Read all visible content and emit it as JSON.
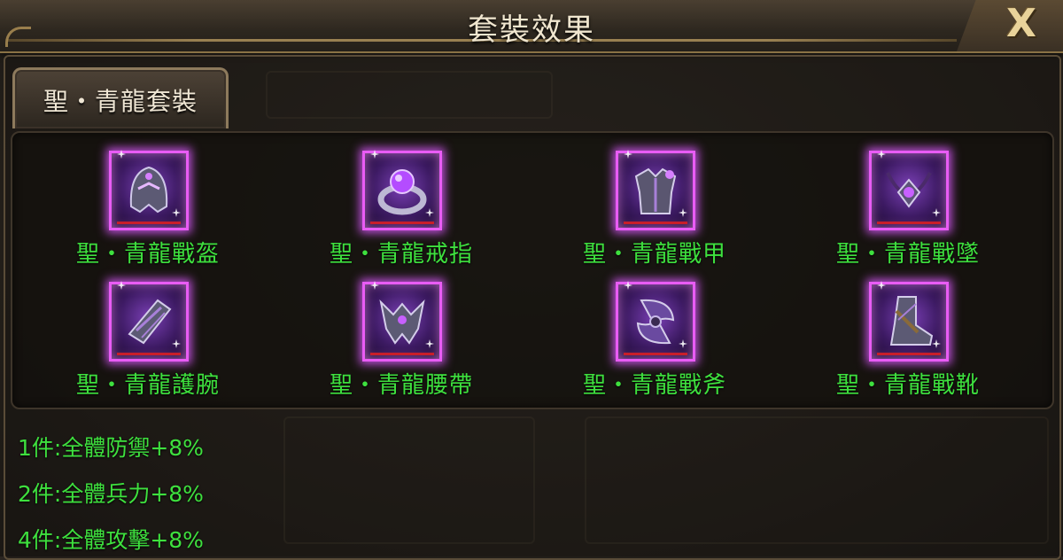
{
  "window": {
    "title": "套裝效果",
    "close_label": "X"
  },
  "tabs": [
    {
      "label": "聖・青龍套裝",
      "selected": true
    }
  ],
  "items": [
    {
      "name": "聖・青龍戰盔",
      "icon": "helmet-icon"
    },
    {
      "name": "聖・青龍戒指",
      "icon": "ring-icon"
    },
    {
      "name": "聖・青龍戰甲",
      "icon": "armor-icon"
    },
    {
      "name": "聖・青龍戰墜",
      "icon": "pendant-icon"
    },
    {
      "name": "聖・青龍護腕",
      "icon": "bracer-icon"
    },
    {
      "name": "聖・青龍腰帶",
      "icon": "belt-icon"
    },
    {
      "name": "聖・青龍戰斧",
      "icon": "axe-icon"
    },
    {
      "name": "聖・青龍戰靴",
      "icon": "boots-icon"
    }
  ],
  "set_bonuses": [
    "1件:全體防禦+8%",
    "2件:全體兵力+8%",
    "4件:全體攻擊+8%"
  ],
  "colors": {
    "item_text": "#3ee03e",
    "icon_border": "#e95cf5",
    "title_text": "#f0e6cf"
  }
}
